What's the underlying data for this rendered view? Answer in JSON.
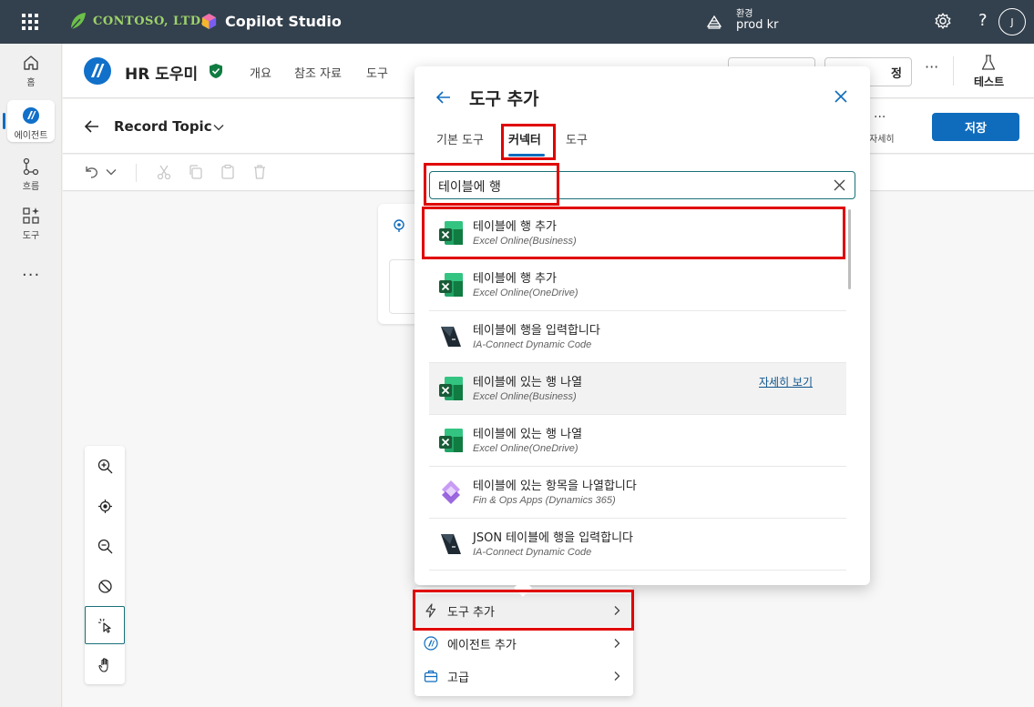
{
  "topbar": {
    "org_name": "CONTOSO, LTD.",
    "app_title": "Copilot Studio",
    "env_label": "환경",
    "env_value": "prod kr",
    "help": "?",
    "avatar_initial": "J"
  },
  "rail": {
    "items": [
      {
        "label": "홈",
        "icon": "home-icon"
      },
      {
        "label": "에이전트",
        "icon": "agent-icon"
      },
      {
        "label": "흐름",
        "icon": "flow-icon"
      },
      {
        "label": "도구",
        "icon": "tools-icon"
      }
    ],
    "more": "···"
  },
  "agent": {
    "name": "HR 도우미",
    "nav": [
      "개요",
      "참조 자료",
      "도구"
    ],
    "btn_partial": "정",
    "more": "···",
    "test_label": "테스트"
  },
  "topic": {
    "title": "Record Topic",
    "details_dots": "···",
    "details_label": "자세히",
    "save_label": "저장"
  },
  "dialog": {
    "title": "도구 추가",
    "tabs": [
      "기본 도구",
      "커넥터",
      "도구"
    ],
    "active_tab": "커넥터",
    "search_value": "테이블에 행",
    "results": [
      {
        "title": "테이블에 행 추가",
        "subtitle": "Excel Online(Business)",
        "icon": "excel-icon"
      },
      {
        "title": "테이블에 행 추가",
        "subtitle": "Excel Online(OneDrive)",
        "icon": "excel-icon"
      },
      {
        "title": "테이블에 행을 입력합니다",
        "subtitle": "IA-Connect Dynamic Code",
        "icon": "ia-connect-icon"
      },
      {
        "title": "테이블에 있는 행 나열",
        "subtitle": "Excel Online(Business)",
        "icon": "excel-icon",
        "link": "자세히 보기"
      },
      {
        "title": "테이블에 있는 행 나열",
        "subtitle": "Excel Online(OneDrive)",
        "icon": "excel-icon"
      },
      {
        "title": "테이블에 있는 항목을 나열합니다",
        "subtitle": "Fin & Ops Apps (Dynamics 365)",
        "icon": "dynamics-icon"
      },
      {
        "title": "JSON 테이블에 행을 입력합니다",
        "subtitle": "IA-Connect Dynamic Code",
        "icon": "ia-connect-icon"
      }
    ]
  },
  "menu": {
    "items": [
      {
        "label": "도구 추가",
        "icon": "lightning-icon"
      },
      {
        "label": "에이전트 추가",
        "icon": "agent-small-icon"
      },
      {
        "label": "고급",
        "icon": "briefcase-icon"
      }
    ]
  },
  "colors": {
    "topbar": "#33404d",
    "accent": "#0f6cbd",
    "highlight": "#e00000",
    "search_border": "#1a6f78"
  }
}
